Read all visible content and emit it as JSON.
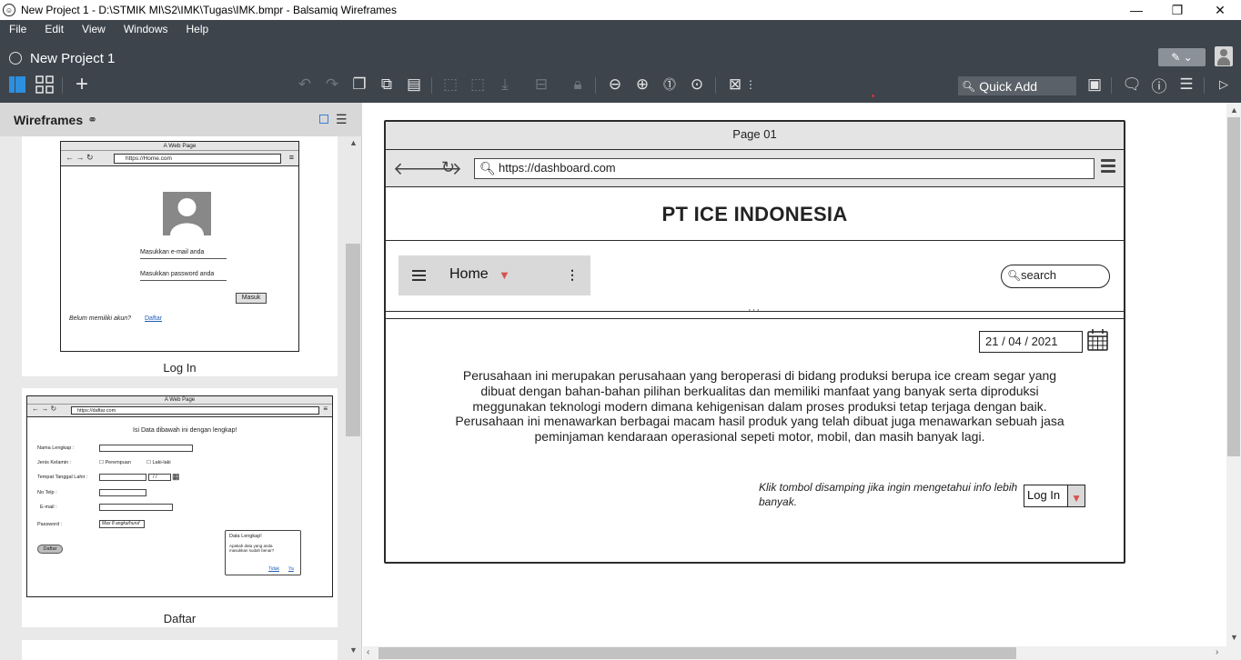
{
  "window": {
    "title": "New Project 1 - D:\\STMIK MI\\S2\\IMK\\Tugas\\IMK.bmpr - Balsamiq Wireframes",
    "minimize": "—",
    "restore": "❐",
    "close": "✕"
  },
  "menu": [
    "File",
    "Edit",
    "View",
    "Windows",
    "Help"
  ],
  "project": {
    "name": "New Project 1"
  },
  "toolbar": {
    "quick_add_placeholder": "Quick Add",
    "edit_mode_icon": "pencil-icon"
  },
  "left_panel": {
    "title": "Wireframes",
    "cards": [
      {
        "label": "Log In",
        "mini": {
          "title": "A Web Page",
          "url": "https://Home.com",
          "email_placeholder": "Masukkan e-mail anda",
          "password_placeholder": "Masukkan password anda",
          "button": "Masuk",
          "no_account": "Belum memiliki akun?",
          "link": "Daftar"
        }
      },
      {
        "label": "Daftar",
        "mini": {
          "title": "A Web Page",
          "url": "https://daftar.com",
          "heading": "Isi Data dibawah ini dengan lengkap!",
          "fields": [
            "Nama Lengkap :",
            "Jenis Kelamin :",
            "Tempat Tanggal Lahir :",
            "No Telp :",
            "E-mail :",
            "Password :"
          ],
          "gender": [
            "Perempuan",
            "Laki-laki"
          ],
          "date": "/ /",
          "password_hint": "Max 8 angka/huruf",
          "button": "Daftar",
          "dialog": {
            "title": "Data Lengkap!",
            "body": "Apakah data yang anda masukkan sudah benar?",
            "no": "Tidak",
            "yes": "Ya"
          }
        }
      }
    ]
  },
  "wireframe": {
    "page_title": "Page 01",
    "url": "https://dashboard.com",
    "heading": "PT ICE INDONESIA",
    "menu_label": "Home",
    "search_placeholder": "search",
    "date": "21 / 04 / 2021",
    "paragraph": "Perusahaan ini merupakan perusahaan yang beroperasi di bidang produksi berupa ice cream segar yang dibuat dengan bahan-bahan pilihan berkualitas dan memiliki manfaat yang banyak serta diproduksi meggunakan teknologi modern dimana kehigenisan dalam proses produksi tetap terjaga dengan baik. Perusahaan ini menawarkan berbagai macam hasil produk yang telah dibuat juga menawarkan sebuah jasa peminjaman kendaraan operasional sepeti motor, mobil, dan masih banyak lagi.",
    "note": "Klik tombol disamping jika ingin mengetahui info lebih banyak.",
    "login_button": "Log In"
  }
}
